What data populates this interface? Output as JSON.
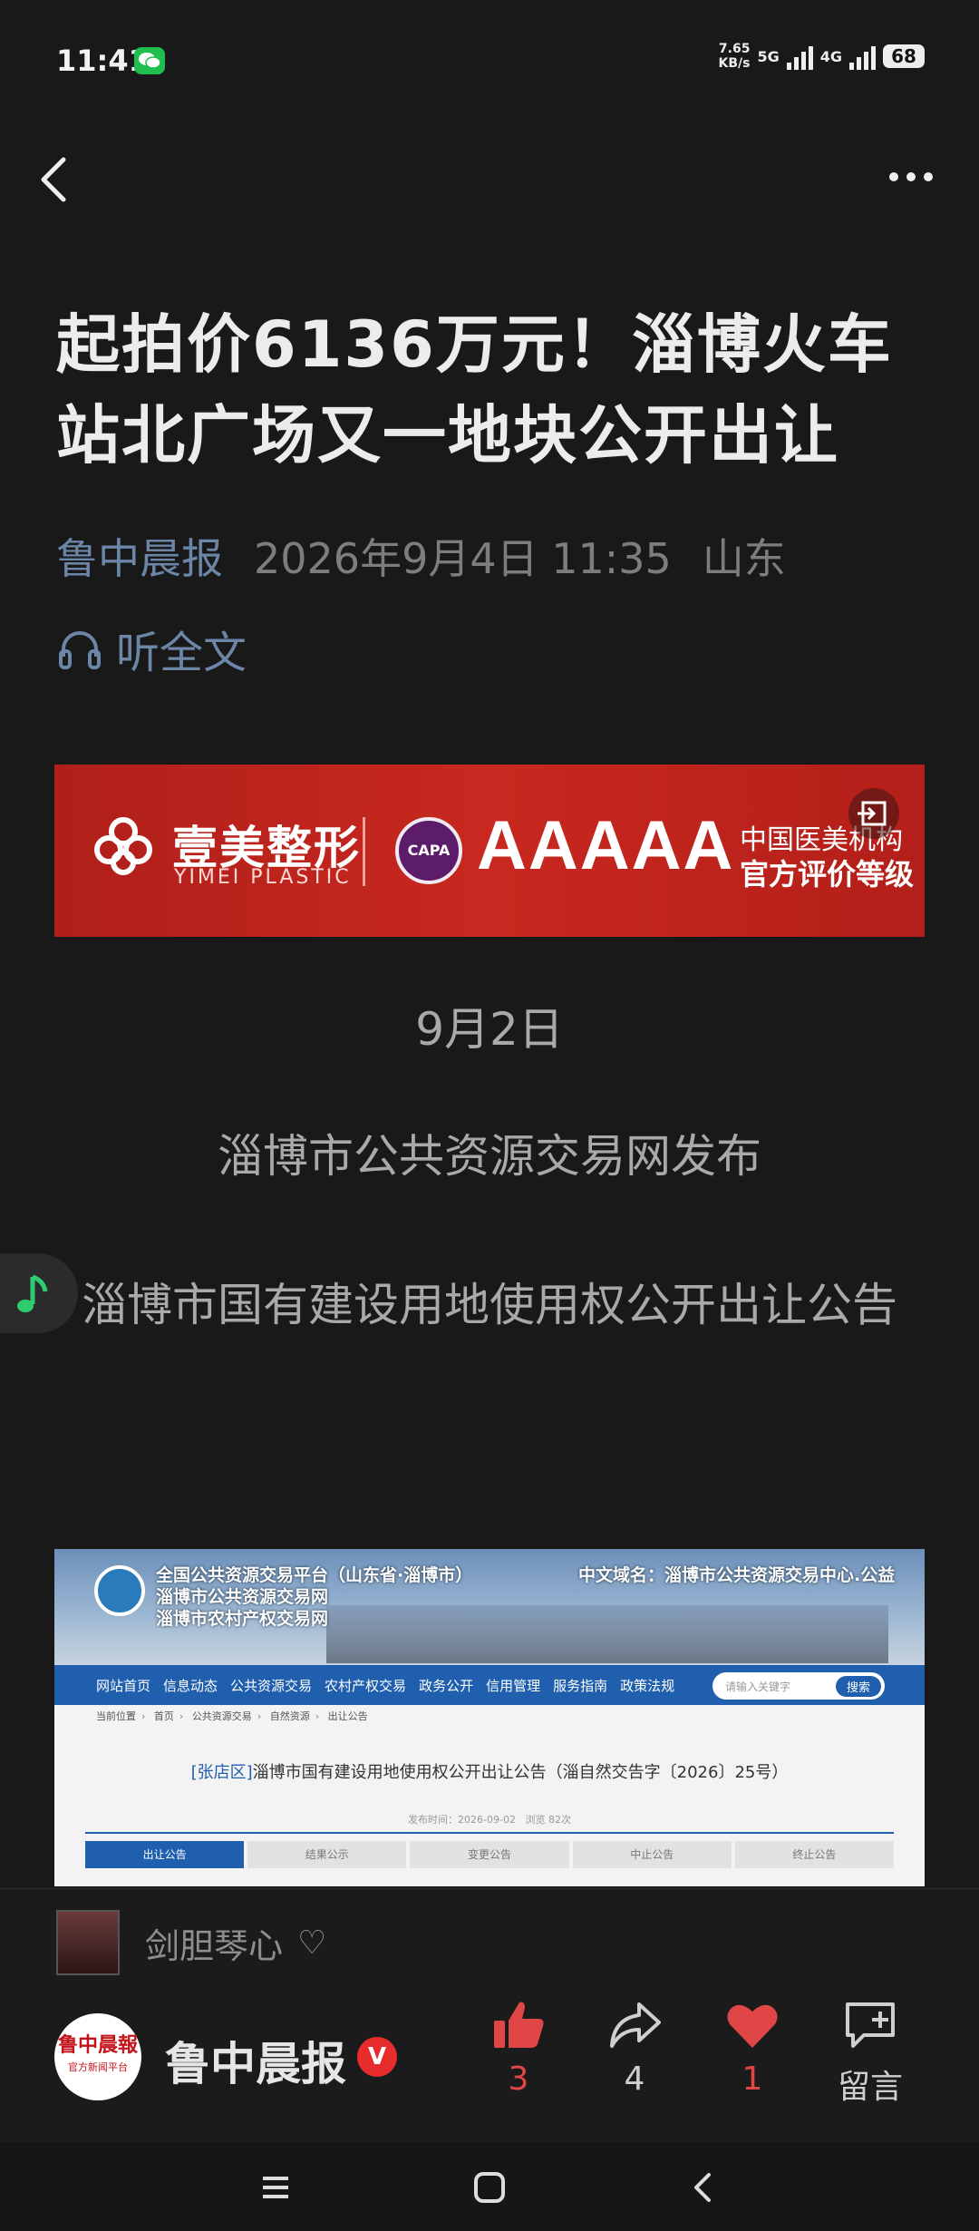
{
  "status_bar": {
    "time": "11:41",
    "net_speed_value": "7.65",
    "net_speed_unit": "KB/s",
    "signal_1": "5G",
    "signal_2": "4G",
    "battery": "68"
  },
  "article": {
    "title": "起拍价6136万元！淄博火车站北广场又一地块公开出让",
    "source": "鲁中晨报",
    "date": "2026年9月4日 11:35",
    "location": "山东",
    "listen_label": "听全文"
  },
  "ad": {
    "brand": "壹美整形",
    "brand_en": "YIMEI PLASTIC",
    "badge": "CAPA",
    "grade": "AAAAA",
    "line1": "中国医美机构",
    "line2": "官方评价等级"
  },
  "body": {
    "para1": "9月2日",
    "para2": "淄博市公共资源交易网发布",
    "para3": "淄博市国有建设用地使用权公开出让公告"
  },
  "embedded_screenshot": {
    "header_line1": "全国公共资源交易平台（山东省·淄博市）",
    "header_line2": "淄博市公共资源交易网",
    "header_line3": "淄博市农村产权交易网",
    "domain": "中文域名：淄博市公共资源交易中心.公益",
    "nav": [
      "网站首页",
      "信息动态",
      "公共资源交易",
      "农村产权交易",
      "政务公开",
      "信用管理",
      "服务指南",
      "政策法规"
    ],
    "search_placeholder": "请输入关键字",
    "search_button": "搜索",
    "breadcrumb": [
      "当前位置",
      "首页",
      "公共资源交易",
      "自然资源",
      "出让公告"
    ],
    "district": "[张店区]",
    "notice_title": "淄博市国有建设用地使用权公开出让公告（淄自然交告字〔2026〕25号）",
    "publish_label": "发布时间：",
    "publish_date": "2026-09-02",
    "views": "浏览 82次",
    "tabs": [
      "出让公告",
      "结果公示",
      "变更公告",
      "中止公告",
      "终止公告"
    ]
  },
  "music": {
    "title": "剑胆琴心"
  },
  "author": {
    "name": "鲁中晨报",
    "avatar_text": "鲁中晨報",
    "avatar_sub": "官方新闻平台",
    "verified": "V"
  },
  "actions": {
    "like_count": "3",
    "share_count": "4",
    "favorite_count": "1",
    "comment_label": "留言"
  },
  "colors": {
    "background": "#191919",
    "accent_blue": "#6b86a6",
    "like_red": "#e04646"
  }
}
